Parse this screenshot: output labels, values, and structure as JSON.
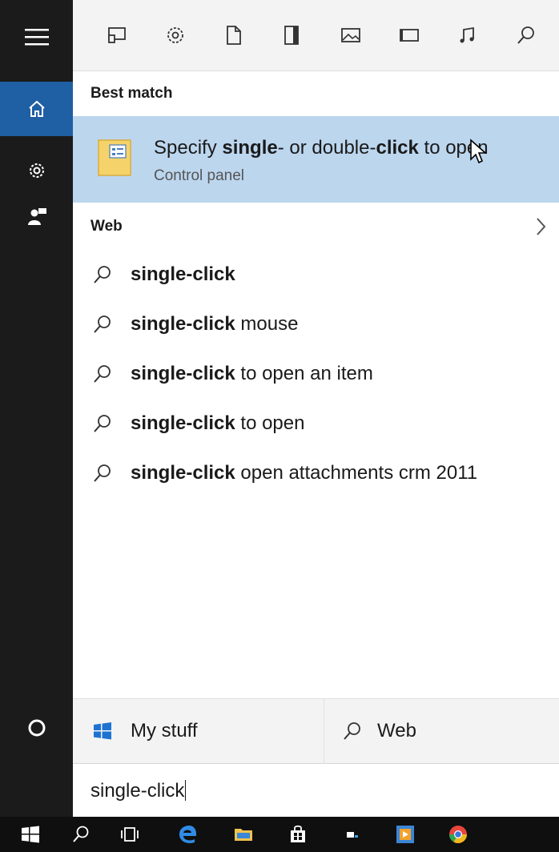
{
  "rail": {
    "items": [
      {
        "icon": "hamburger-menu-icon"
      },
      {
        "icon": "home-icon"
      },
      {
        "icon": "gear-icon"
      },
      {
        "icon": "feedback-icon"
      },
      {
        "icon": "cortana-circle-icon"
      }
    ]
  },
  "filters": [
    "apps-icon",
    "settings-icon",
    "documents-icon",
    "folders-icon",
    "photos-icon",
    "videos-icon",
    "music-icon",
    "search-icon"
  ],
  "best_match": {
    "heading": "Best match",
    "title_parts": {
      "a": "Specify ",
      "b": "single",
      "c": "- or double-",
      "d": "click",
      "e": " to open"
    },
    "subtitle": "Control panel"
  },
  "web": {
    "heading": "Web",
    "suggestions": [
      {
        "bold": "single-click",
        "rest": ""
      },
      {
        "bold": "single-click",
        "rest": " mouse"
      },
      {
        "bold": "single-click",
        "rest": " to open an item"
      },
      {
        "bold": "single-click",
        "rest": " to open"
      },
      {
        "bold": "single-click",
        "rest": " open attachments crm 2011"
      }
    ]
  },
  "bottom_tabs": {
    "my_stuff": "My stuff",
    "web": "Web"
  },
  "search": {
    "value": "single-click"
  },
  "colors": {
    "rail": "#1b1b1b",
    "accent": "#1f5fa4",
    "selection": "#bcd6ee",
    "filter_bar": "#f3f3f3",
    "taskbar": "#0f0f0f"
  },
  "taskbar": [
    "windows-start-icon",
    "search-icon",
    "task-view-icon",
    "edge-icon",
    "file-explorer-icon",
    "store-icon",
    "terminal-icon",
    "media-app-icon",
    "chrome-icon"
  ]
}
